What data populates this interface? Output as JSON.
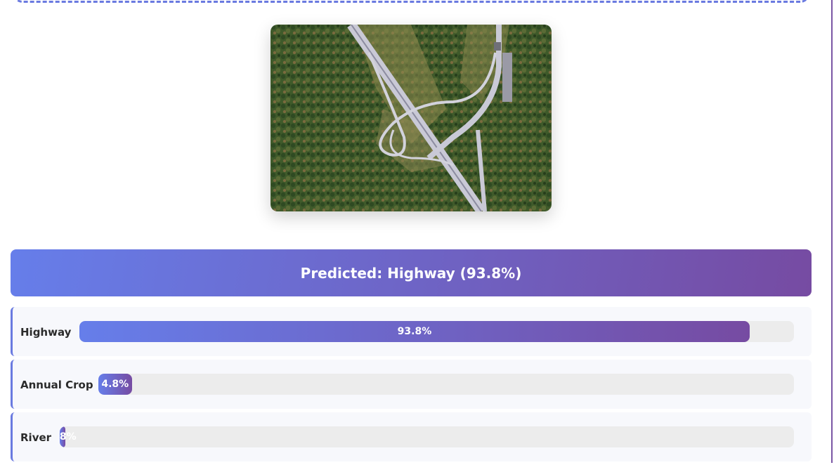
{
  "prediction": {
    "banner_text": "Predicted: Highway (93.8%)"
  },
  "image": {
    "icon": "aerial-highway-interchange-image"
  },
  "probabilities": [
    {
      "label": "Highway",
      "percent_text": "93.8%",
      "value": 0.938
    },
    {
      "label": "Annual Crop",
      "percent_text": "4.8%",
      "value": 0.048
    },
    {
      "label": "River",
      "percent_text": "0.8%",
      "value": 0.008
    }
  ],
  "colors": {
    "gradient_start": "#667eea",
    "gradient_end": "#764ba2",
    "track": "#ececec",
    "row_bg": "#f7f8fc"
  }
}
